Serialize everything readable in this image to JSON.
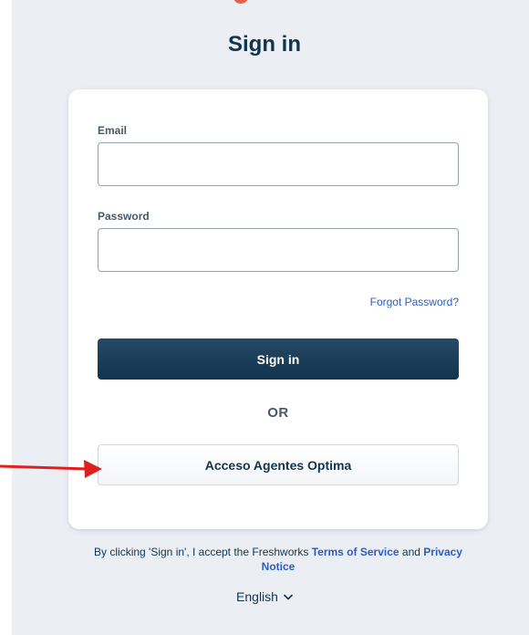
{
  "page": {
    "title": "Sign in"
  },
  "form": {
    "email_label": "Email",
    "email_value": "",
    "password_label": "Password",
    "password_value": "",
    "forgot_password": "Forgot Password?",
    "sign_in_button": "Sign in",
    "or_divider": "OR",
    "sso_button": "Acceso Agentes Optima"
  },
  "footer": {
    "consent_prefix": "By clicking 'Sign in', I accept the Freshworks",
    "terms_link": "Terms of Service",
    "conjunction": "and",
    "privacy_link": "Privacy Notice",
    "language": "English"
  },
  "icons": {
    "language_dropdown": "chevron-down-icon",
    "annotation": "red-arrow-icon"
  },
  "colors": {
    "panel_background": "#ebeef3",
    "primary": "#12344d",
    "link": "#2c5cc5",
    "annotation_arrow": "#e02020"
  }
}
